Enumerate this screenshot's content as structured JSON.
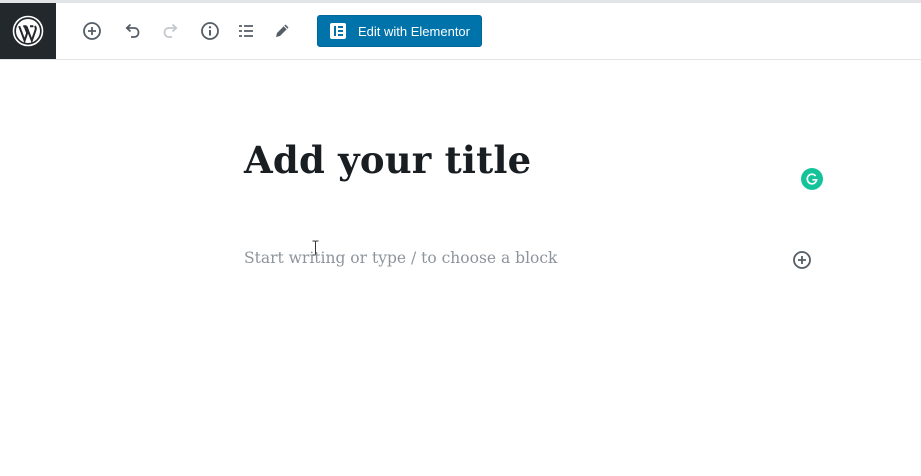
{
  "toolbar": {
    "logo_icon": "wordpress-logo-icon",
    "icons": [
      "add-block-icon",
      "undo-icon",
      "redo-icon",
      "info-icon",
      "block-navigation-icon",
      "pencil-icon"
    ],
    "elementor_button_label": "Edit with Elementor",
    "accent_color": "#0073aa"
  },
  "editor": {
    "title_placeholder": "Add your title",
    "block_placeholder": "Start writing or type / to choose a block",
    "grammarly_icon": "grammarly-icon",
    "grammarly_color": "#15c39a"
  }
}
